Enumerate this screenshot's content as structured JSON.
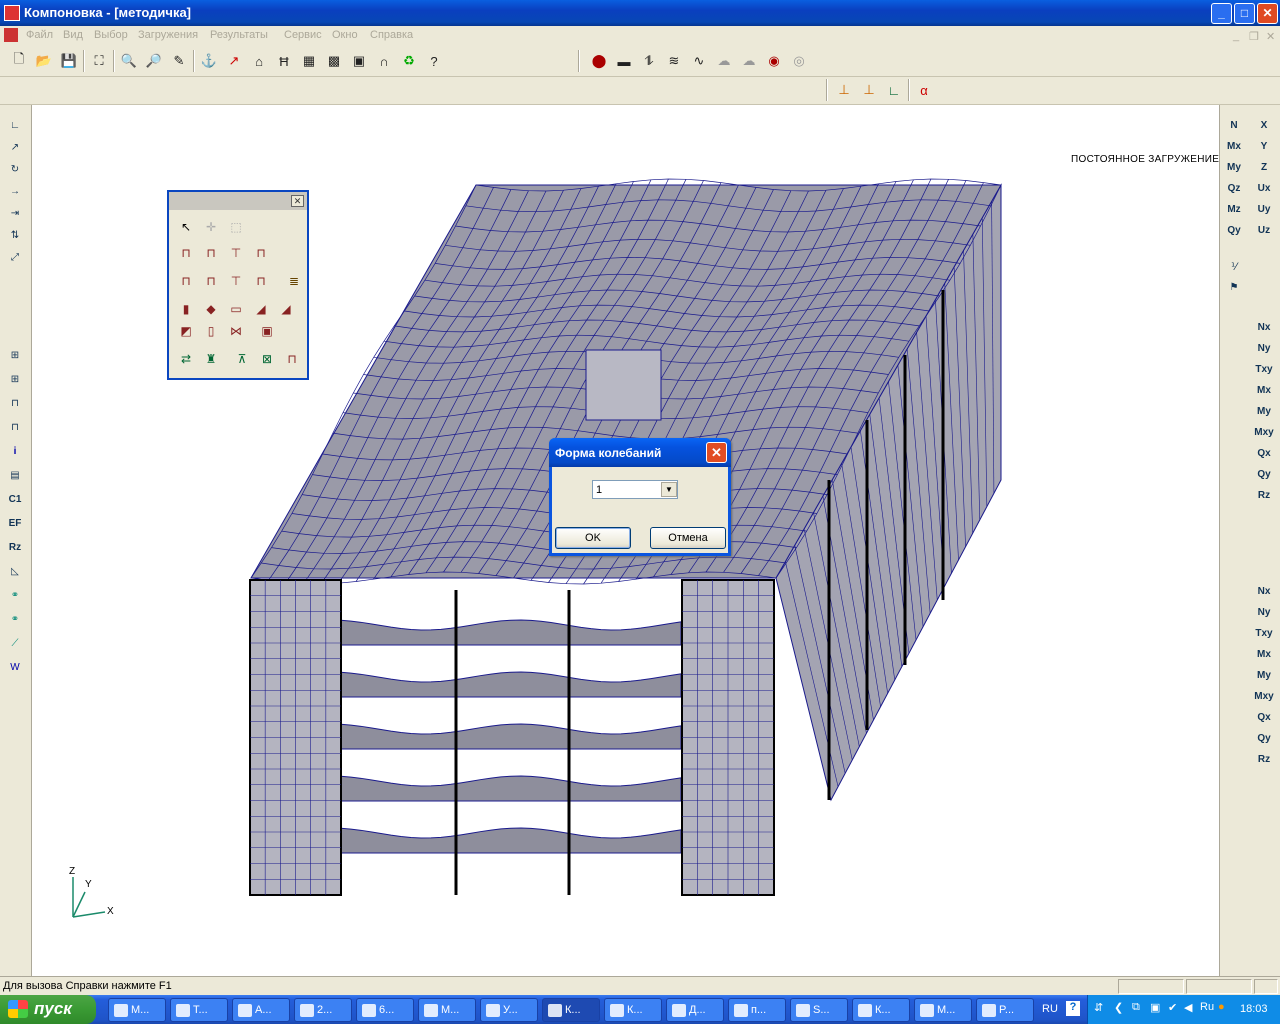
{
  "window": {
    "title": "Компоновка - [методичка]",
    "minimize": "_",
    "maximize": "□",
    "close": "✕"
  },
  "menu": [
    "Файл",
    "Вид",
    "Выбор",
    "Загружения",
    "Результаты",
    "Сервис",
    "Окно",
    "Справка"
  ],
  "canvas": {
    "load_case_label": "ПОСТОЯННОЕ ЗАГРУЖЕНИЕ",
    "axes": {
      "z": "Z",
      "y": "Y",
      "x": "X"
    }
  },
  "right_toolbar_a": [
    "N",
    "Mx",
    "My",
    "Qz",
    "Mz",
    "Qy"
  ],
  "right_toolbar_b": [
    "X",
    "Y",
    "Z",
    "Ux",
    "Uy",
    "Uz"
  ],
  "right_toolbar_c": [
    "Nx",
    "Ny",
    "Txy",
    "Mx",
    "My",
    "Mxy",
    "Qx",
    "Qy",
    "Rz"
  ],
  "right_toolbar_d": [
    "Nx",
    "Ny",
    "Txy",
    "Mx",
    "My",
    "Mxy",
    "Qx",
    "Qy",
    "Rz"
  ],
  "left_toolbar_labels": {
    "info": "i",
    "c1": "C1",
    "ef": "EF",
    "rz": "Rz"
  },
  "dialog": {
    "title": "Форма колебаний",
    "value": "1",
    "ok": "OK",
    "cancel": "Отмена"
  },
  "status": {
    "text": "Для вызова Справки нажмите F1"
  },
  "taskbar": {
    "start": "пуск",
    "tasks": [
      "M...",
      "T...",
      "A...",
      "2...",
      "6...",
      "M...",
      "У...",
      "К...",
      "К...",
      "Д...",
      "п...",
      "S...",
      "К...",
      "M...",
      "P..."
    ],
    "lang": "RU",
    "clock": "18:03"
  },
  "colors": {
    "mesh": "#1a1a8c",
    "shell": "#9a9aa8",
    "accent": "#0a55e0"
  }
}
